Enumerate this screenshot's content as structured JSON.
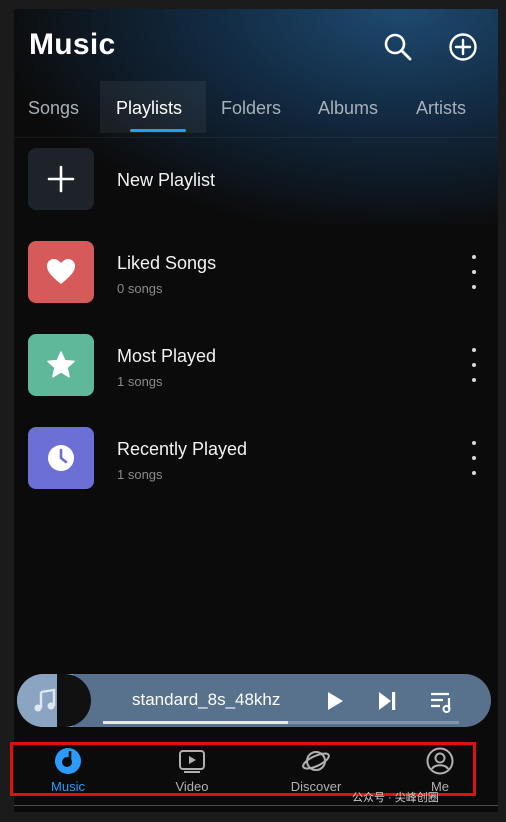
{
  "header": {
    "title": "Music",
    "icons": [
      "search-icon",
      "add-circle-icon"
    ]
  },
  "tabs": [
    {
      "label": "Songs",
      "active": false
    },
    {
      "label": "Playlists",
      "active": true
    },
    {
      "label": "Folders",
      "active": false
    },
    {
      "label": "Albums",
      "active": false
    },
    {
      "label": "Artists",
      "active": false
    }
  ],
  "new_playlist": {
    "label": "New Playlist",
    "icon": "plus-icon"
  },
  "playlists": [
    {
      "title": "Liked Songs",
      "count": "0 songs",
      "color": "#d65a5a",
      "icon": "heart-icon"
    },
    {
      "title": "Most Played",
      "count": "1 songs",
      "color": "#5fb89a",
      "icon": "star-icon"
    },
    {
      "title": "Recently Played",
      "count": "1 songs",
      "color": "#6b6fd6",
      "icon": "clock-icon"
    }
  ],
  "player": {
    "track": "standard_8s_48khz",
    "progress": 0.52,
    "controls": [
      "play-icon",
      "skip-next-icon",
      "queue-music-icon"
    ]
  },
  "bottom_nav": [
    {
      "label": "Music",
      "icon": "music-disc-icon",
      "active": true
    },
    {
      "label": "Video",
      "icon": "video-icon",
      "active": false
    },
    {
      "label": "Discover",
      "icon": "planet-icon",
      "active": false
    },
    {
      "label": "Me",
      "icon": "person-circle-icon",
      "active": false
    }
  ],
  "colors": {
    "accent": "#1da1f2",
    "active_nav": "#2a9cff",
    "highlight_box": "#e01010",
    "background": "#0b0b0b"
  },
  "watermark": "公众号 · 尖峰创圈"
}
